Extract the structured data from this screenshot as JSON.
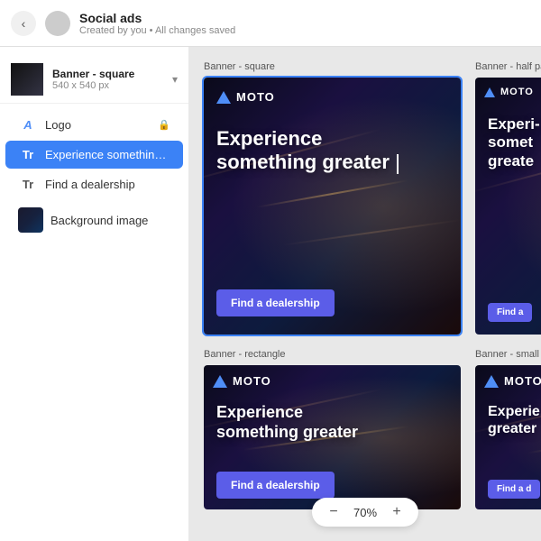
{
  "topbar": {
    "title": "Social ads",
    "subtitle": "Created by you  •  All changes saved",
    "back_label": "‹"
  },
  "sidebar": {
    "banner_name": "Banner - square",
    "banner_size": "540 x 540 px",
    "items": [
      {
        "id": "logo",
        "label": "Logo",
        "type": "text-icon",
        "locked": true
      },
      {
        "id": "experience",
        "label": "Experience something...",
        "type": "text-icon",
        "active": true
      },
      {
        "id": "dealership",
        "label": "Find a dealership",
        "type": "text-icon"
      },
      {
        "id": "background",
        "label": "Background image",
        "type": "thumb"
      }
    ]
  },
  "banners": [
    {
      "id": "square",
      "label": "Banner - square",
      "size": "square",
      "selected": true,
      "logo": "MOTO",
      "headline_line1": "Experience",
      "headline_line2": "something greater",
      "cta": "Find a dealership",
      "has_cursor": true
    },
    {
      "id": "half-page",
      "label": "Banner - half page",
      "size": "half",
      "selected": false,
      "logo": "MOTO",
      "headline_line1": "Experi-",
      "headline_line2": "somet",
      "headline_line3": "greate",
      "cta": "Find a",
      "truncated": true
    },
    {
      "id": "rectangle",
      "label": "Banner - rectangle",
      "size": "rect",
      "selected": false,
      "logo": "MOTO",
      "headline_line1": "Experience",
      "headline_line2": "something greater",
      "cta": "Find a dealership"
    },
    {
      "id": "small-sq",
      "label": "Banner - small sq...",
      "size": "small",
      "selected": false,
      "logo": "MOTO",
      "headline_line1": "Experie...",
      "headline_line2": "greater",
      "cta": "Find a d"
    }
  ],
  "zoom": {
    "value": "70%",
    "minus_label": "−",
    "plus_label": "+"
  }
}
